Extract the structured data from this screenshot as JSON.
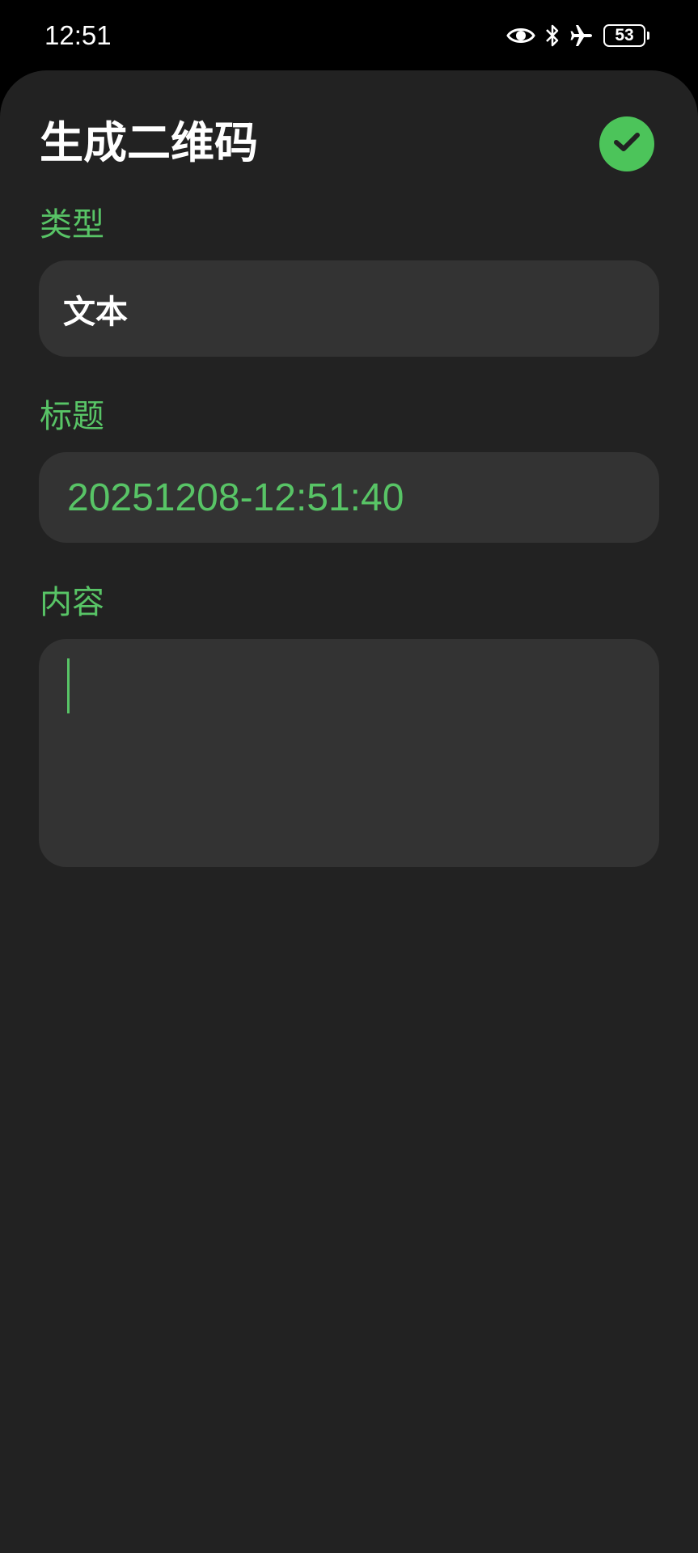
{
  "status_bar": {
    "time": "12:51",
    "icons": [
      "eye-icon",
      "bluetooth-icon",
      "airplane-mode-icon"
    ],
    "battery_level": "53"
  },
  "header": {
    "title": "生成二维码",
    "confirm_icon": "checkmark-icon"
  },
  "form": {
    "type": {
      "label": "类型",
      "value": "文本"
    },
    "title": {
      "label": "标题",
      "value": "20251208-12:51:40"
    },
    "content": {
      "label": "内容",
      "value": ""
    }
  },
  "colors": {
    "accent": "#4cc45a",
    "accent_text": "#58c466",
    "background": "#222222",
    "field_background": "#333333"
  }
}
